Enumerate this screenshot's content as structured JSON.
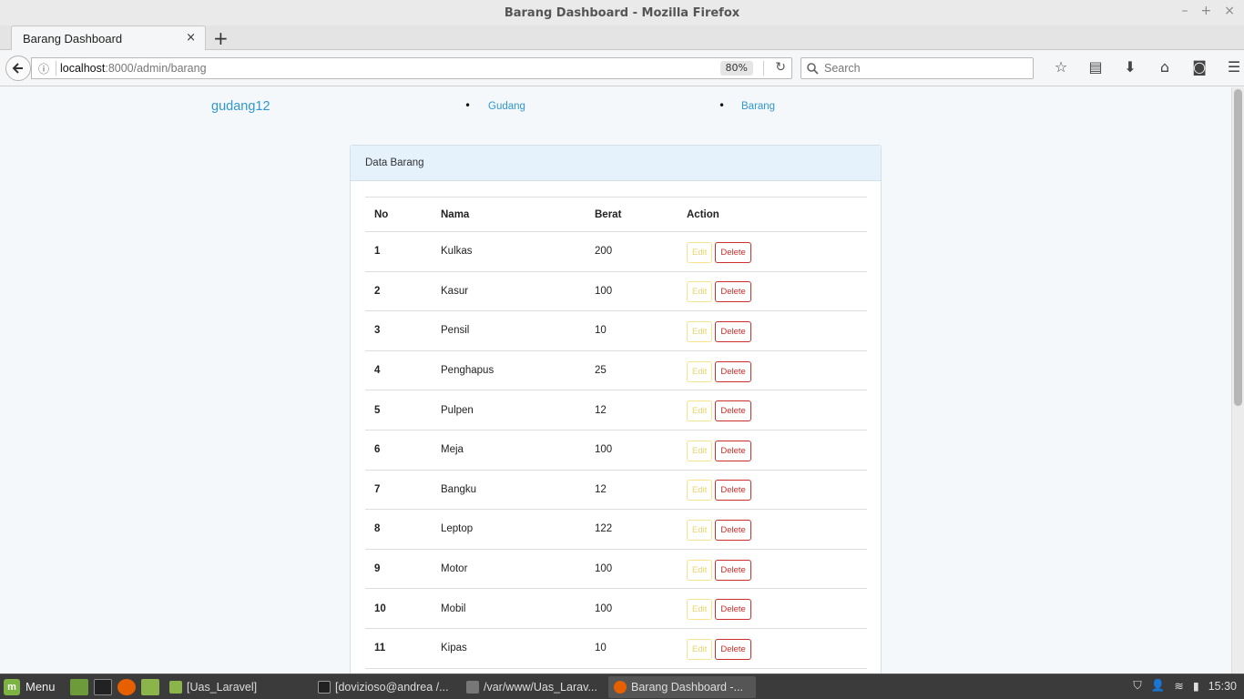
{
  "window": {
    "title": "Barang Dashboard - Mozilla Firefox",
    "controls": [
      "–",
      "+",
      "×"
    ]
  },
  "tab": {
    "label": "Barang Dashboard",
    "close": "×",
    "new_tab": "+"
  },
  "url": {
    "host": "localhost",
    "path": ":8000/admin/barang",
    "zoom": "80%"
  },
  "search": {
    "placeholder": "Search"
  },
  "page": {
    "brand": "gudang12",
    "nav": [
      {
        "label": "Gudang"
      },
      {
        "label": "Barang"
      }
    ],
    "panel_title": "Data Barang",
    "table": {
      "headers": [
        "No",
        "Nama",
        "Berat",
        "Action"
      ],
      "edit_label": "Edit",
      "delete_label": "Delete",
      "rows": [
        {
          "no": "1",
          "nama": "Kulkas",
          "berat": "200"
        },
        {
          "no": "2",
          "nama": "Kasur",
          "berat": "100"
        },
        {
          "no": "3",
          "nama": "Pensil",
          "berat": "10"
        },
        {
          "no": "4",
          "nama": "Penghapus",
          "berat": "25"
        },
        {
          "no": "5",
          "nama": "Pulpen",
          "berat": "12"
        },
        {
          "no": "6",
          "nama": "Meja",
          "berat": "100"
        },
        {
          "no": "7",
          "nama": "Bangku",
          "berat": "12"
        },
        {
          "no": "8",
          "nama": "Leptop",
          "berat": "122"
        },
        {
          "no": "9",
          "nama": "Motor",
          "berat": "100"
        },
        {
          "no": "10",
          "nama": "Mobil",
          "berat": "100"
        },
        {
          "no": "11",
          "nama": "Kipas",
          "berat": "10"
        }
      ]
    }
  },
  "taskbar": {
    "menu_label": "Menu",
    "tasks": [
      {
        "label": "[Uas_Laravel]"
      },
      {
        "label": "[dovizioso@andrea /..."
      },
      {
        "label": "/var/www/Uas_Larav..."
      },
      {
        "label": "Barang Dashboard -..."
      }
    ],
    "clock": "15:30"
  },
  "colors": {
    "link": "#3097d1",
    "panel_heading": "#e5f1fb",
    "delete": "#c9302c",
    "edit": "#f7e38c"
  }
}
